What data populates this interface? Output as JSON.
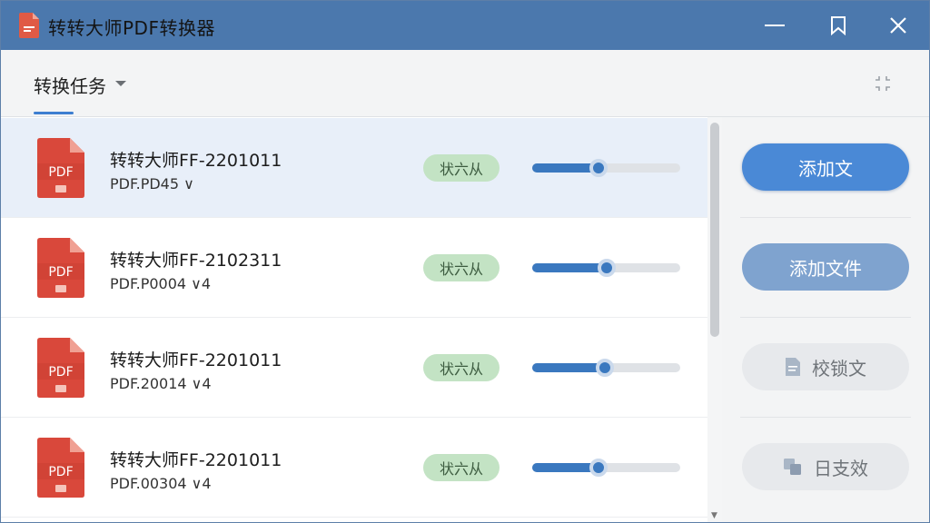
{
  "window": {
    "title": "转转大师PDF转换器",
    "titlebar_color": "#4b78ad",
    "controls": [
      "minimize-icon",
      "bookmark-icon",
      "close-icon"
    ]
  },
  "tabrow": {
    "tab_label": "转换任务",
    "accent": "#3e7fd0"
  },
  "files": [
    {
      "name": "转转大师FF-2201011",
      "meta": "PDF.PD45  ∨",
      "status": "状六从",
      "progress": 0.45,
      "selected": true
    },
    {
      "name": "转转大师FF-2102311",
      "meta": "PDF.P0004  ∨4",
      "status": "状六从",
      "progress": 0.5,
      "selected": false
    },
    {
      "name": "转转大师FF-2201011",
      "meta": "PDF.20014  ∨4",
      "status": "状六从",
      "progress": 0.49,
      "selected": false
    },
    {
      "name": "转转大师FF-2201011",
      "meta": "PDF.00304  ∨4",
      "status": "状六从",
      "progress": 0.45,
      "selected": false
    }
  ],
  "file_icon_label": "PDF",
  "side": {
    "add_text_label": "添加文",
    "add_file_label": "添加文件",
    "proofread_label": "校锁文",
    "daily_label": "日支效"
  },
  "colors": {
    "primary": "#4a89d6",
    "secondary": "#7fa3cf",
    "status_bg": "#c3e3c4",
    "progress": "#3a78bf",
    "pdf_red": "#d9483b"
  }
}
